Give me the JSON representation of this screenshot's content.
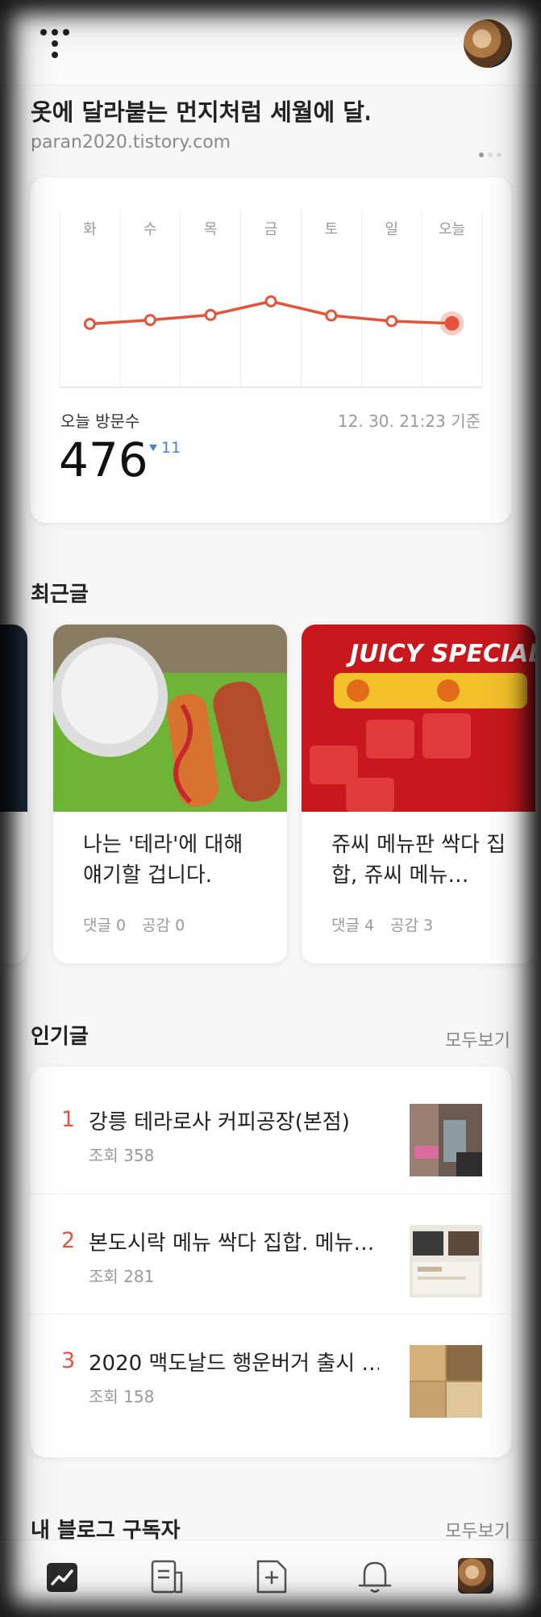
{
  "blog": {
    "title": "옷에 달라붙는 먼지처럼 세월에 달…",
    "url": "paran2020.tistory.com"
  },
  "stats": {
    "visits_label": "오늘 방문수",
    "timestamp": "12. 30. 21:23 기준",
    "visits_value": "476",
    "visits_delta": "11",
    "delta_direction": "down",
    "accent_color": "#e5533b",
    "delta_color": "#4a7fd6"
  },
  "chart_data": {
    "type": "line",
    "categories": [
      "화",
      "수",
      "목",
      "금",
      "토",
      "일",
      "오늘"
    ],
    "values": [
      0.55,
      0.62,
      0.71,
      0.95,
      0.7,
      0.6,
      0.56
    ],
    "grid": true,
    "highlight_last": true
  },
  "recent": {
    "title": "최근글",
    "posts": [
      {
        "title": "나는 '테라'에 대해 얘기할 겁니다.",
        "comments": "댓글 0",
        "likes": "공감 0",
        "image": "food-tray-photo"
      },
      {
        "title": "쥬씨 메뉴판 싹다 집합, 쥬씨 메뉴…",
        "comments": "댓글 4",
        "likes": "공감 3",
        "image": "juicy-special-menu-photo"
      }
    ],
    "juicy_banner": "JUICY SPECIAL"
  },
  "popular": {
    "title": "인기글",
    "see_all": "모두보기",
    "items": [
      {
        "rank": "1",
        "title": "강릉 테라로사 커피공장(본점)",
        "views": "조회 358"
      },
      {
        "rank": "2",
        "title": "본도시락 메뉴 싹다 집합. 메뉴…",
        "views": "조회 281"
      },
      {
        "rank": "3",
        "title": "2020 맥도날드 행운버거 출시 …",
        "views": "조회 158"
      }
    ]
  },
  "subscribers": {
    "title": "내 블로그 구독자",
    "see_all": "모두보기"
  },
  "nav": {
    "items": [
      "stats-icon",
      "posts-icon",
      "new-post-icon",
      "bell-icon",
      "profile-avatar"
    ]
  }
}
